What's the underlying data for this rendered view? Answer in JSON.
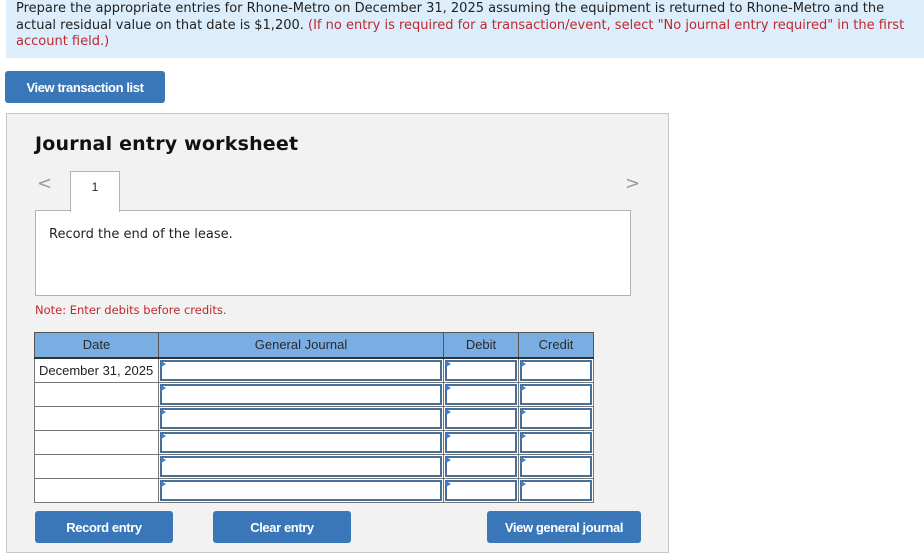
{
  "prompt": {
    "text": "Prepare the appropriate entries for Rhone-Metro on December 31, 2025 assuming the equipment is returned to Rhone-Metro and the actual residual value on that date is $1,200.",
    "instruction": "(If no entry is required for a transaction/event, select \"No journal entry required\" in the first account field.)"
  },
  "buttons": {
    "view_transaction_list": "View transaction list",
    "record_entry": "Record entry",
    "clear_entry": "Clear entry",
    "view_general_journal": "View general journal"
  },
  "worksheet": {
    "title": "Journal entry worksheet",
    "nav_prev_icon": "chevron-left-icon",
    "nav_next_icon": "chevron-right-icon",
    "prev_glyph": "<",
    "next_glyph": ">",
    "active_tab": "1",
    "description": "Record the end of the lease.",
    "note": "Note: Enter debits before credits."
  },
  "table": {
    "headers": [
      "Date",
      "General Journal",
      "Debit",
      "Credit"
    ],
    "rows": [
      {
        "date": "December 31, 2025",
        "account": "",
        "debit": "",
        "credit": ""
      },
      {
        "date": "",
        "account": "",
        "debit": "",
        "credit": ""
      },
      {
        "date": "",
        "account": "",
        "debit": "",
        "credit": ""
      },
      {
        "date": "",
        "account": "",
        "debit": "",
        "credit": ""
      },
      {
        "date": "",
        "account": "",
        "debit": "",
        "credit": ""
      },
      {
        "date": "",
        "account": "",
        "debit": "",
        "credit": ""
      }
    ]
  },
  "colors": {
    "button_bg": "#3a77b8",
    "header_bg": "#7aaee3",
    "prompt_bg": "#dceefb",
    "note_red": "#c0282d"
  }
}
